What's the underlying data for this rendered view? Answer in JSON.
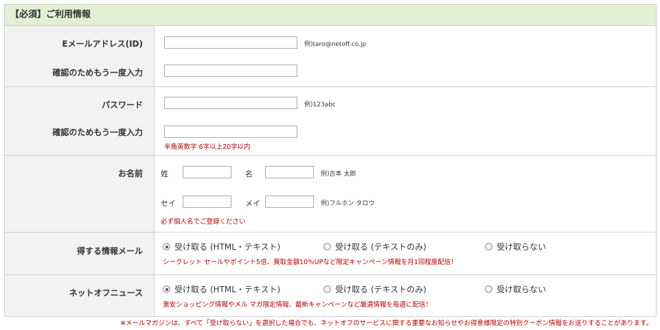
{
  "section_title": "【必須】ご利用情報",
  "email": {
    "label": "Eメールアドレス(ID)",
    "example": "例)taro@netoff.co.jp",
    "confirm_label": "確認のためもう一度入力",
    "value": "",
    "confirm_value": ""
  },
  "password": {
    "label": "パスワード",
    "example": "例)123abc",
    "confirm_label": "確認のためもう一度入力",
    "hint": "半角英数字 6字以上20字以内",
    "value": "",
    "confirm_value": ""
  },
  "name": {
    "label": "お名前",
    "sei_label": "姓",
    "mei_label": "名",
    "example": "例)古本 太郎",
    "sei_kana_label": "セイ",
    "mei_kana_label": "メイ",
    "kana_example": "例)フルホン タロウ",
    "note": "必ず個人名でご登録ください",
    "sei": "",
    "mei": "",
    "sei_kana": "",
    "mei_kana": ""
  },
  "newsletter": {
    "label": "得する情報メール",
    "options": [
      "受け取る (HTML・テキスト)",
      "受け取る (テキストのみ)",
      "受け取らない"
    ],
    "selected": 0,
    "note": "シークレット セールやポイント5倍、買取金額10％UPなど限定キャンペーン情報を月1回程度配信！"
  },
  "netoff_news": {
    "label": "ネットオフニュース",
    "options": [
      "受け取る (HTML・テキスト)",
      "受け取る (テキストのみ)",
      "受け取らない"
    ],
    "selected": 0,
    "note": "激安ショッピング情報やメル マガ限定情報、最新キャンペーンなど厳選情報を毎週に配信！"
  },
  "footer_note": "※メールマガジンは、すべて「受け取らない」を選択した場合でも、ネットオフのサービスに関する重要なお知らせやお得意様限定の特別クーポン情報をお送りすることがあります。",
  "colors": {
    "header_bg": "#e2efd5",
    "label_bg": "#f2f2f2",
    "border": "#cfcfcf",
    "note_red": "#b30000"
  }
}
